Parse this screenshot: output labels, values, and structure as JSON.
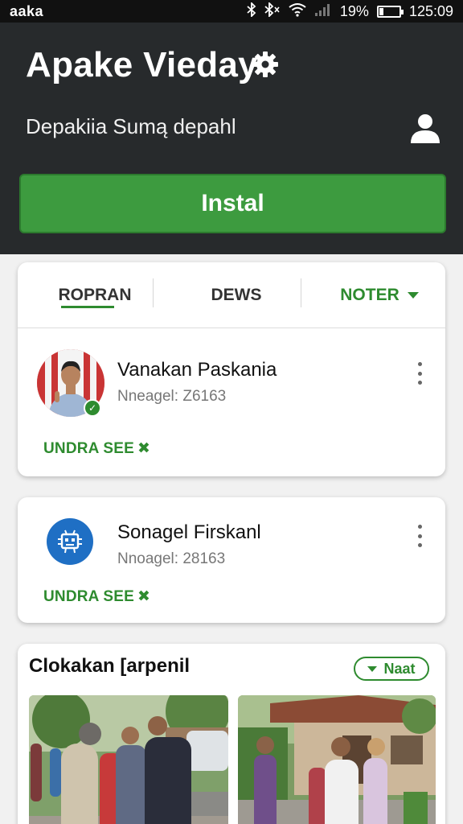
{
  "status_bar": {
    "carrier": "aaka",
    "battery_text": "19%",
    "battery_level": 0.19,
    "time": "125:09",
    "icons": [
      "bluetooth-icon",
      "bluetooth-alt-icon",
      "wifi-icon",
      "signal-icon",
      "battery-icon"
    ]
  },
  "header": {
    "app_title": "Apake Vieday",
    "subtitle": "Depakiia Sumą depahl",
    "install_label": "Instal",
    "install_color": "#3d9b3f"
  },
  "tabs": [
    {
      "label": "ROPRAN",
      "active": true
    },
    {
      "label": "DEWS",
      "active": false
    },
    {
      "label": "NOTER",
      "active": false,
      "has_dropdown": true
    }
  ],
  "items": [
    {
      "name": "Vanakan Paskania",
      "meta": "Nneagel: Z6163",
      "link": "UNDRA SEE",
      "verified": true
    },
    {
      "name": "Sonagel Firskanl",
      "meta": "Nnoagel: 28163",
      "link": "UNDRA SEE"
    }
  ],
  "section": {
    "title": "Clokakan [arpenil",
    "pill_label": "Naat"
  },
  "colors": {
    "accent": "#2e8b2f",
    "header_bg": "#272a2c",
    "app_logo": "#1f6fc4"
  }
}
